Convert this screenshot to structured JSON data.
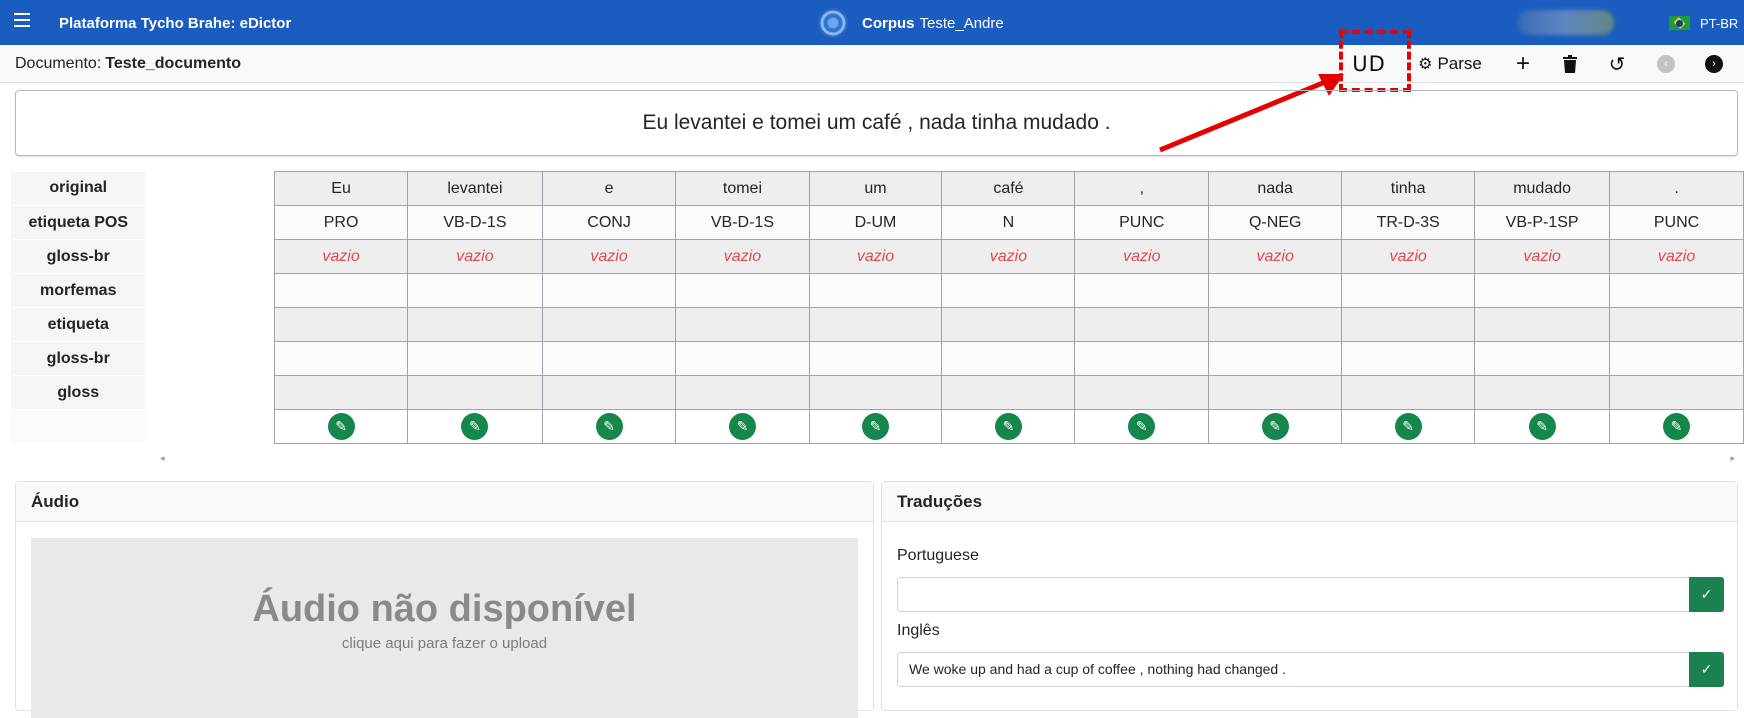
{
  "topbar": {
    "menu_icon": "hamburger-icon",
    "title": "Plataforma Tycho Brahe: eDictor",
    "corpus_label": "Corpus",
    "corpus_name": "Teste_Andre",
    "user_name": "André Rosa",
    "language": "PT-BR"
  },
  "docbar": {
    "label": "Documento:",
    "name": "Teste_documento",
    "ud_label": "UD",
    "parse_label": "Parse",
    "tools": [
      "plus-icon",
      "trash-icon",
      "undo-icon",
      "chevron-left-icon",
      "chevron-right-icon"
    ]
  },
  "sentence": "Eu levantei e tomei um café , nada tinha mudado .",
  "rows": {
    "labels": [
      "original",
      "etiqueta POS",
      "gloss-br",
      "morfemas",
      "etiqueta",
      "gloss-br",
      "gloss"
    ],
    "original": [
      "Eu",
      "levantei",
      "e",
      "tomei",
      "um",
      "café",
      ",",
      "nada",
      "tinha",
      "mudado",
      "."
    ],
    "pos": [
      "PRO",
      "VB-D-1S",
      "CONJ",
      "VB-D-1S",
      "D-UM",
      "N",
      "PUNC",
      "Q-NEG",
      "TR-D-3S",
      "VB-P-1SP",
      "PUNC"
    ],
    "gloss_placeholder": "vazio"
  },
  "audio": {
    "title": "Áudio",
    "unavailable": "Áudio não disponível",
    "upload_hint": "clique aqui para fazer o upload"
  },
  "translations": {
    "title": "Traduções",
    "portuguese_label": "Portuguese",
    "portuguese_value": "",
    "english_label": "Inglês",
    "english_value": "We woke up and had a cup of coffee , nothing had changed ."
  },
  "annotation_color": "#e60000",
  "accent_color": "#1a5cbf"
}
